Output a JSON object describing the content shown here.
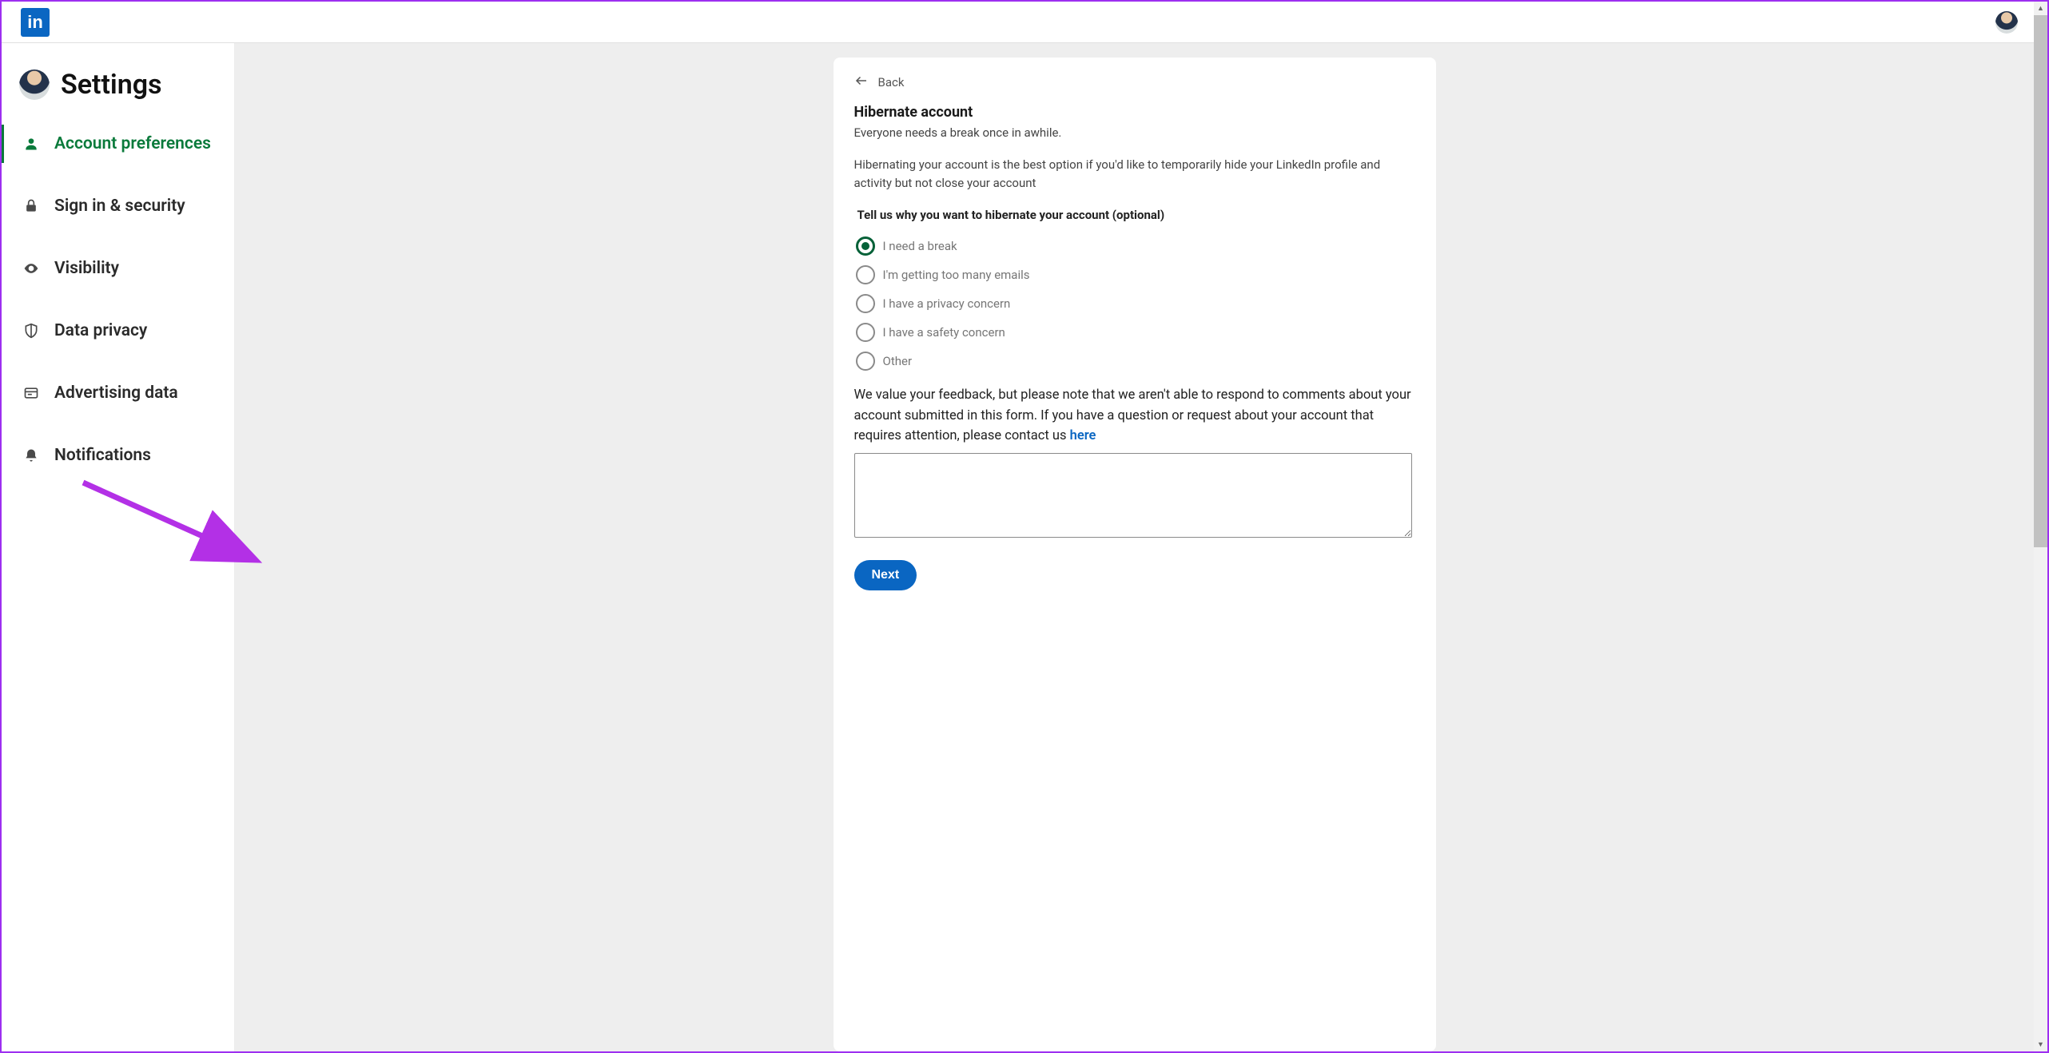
{
  "header": {
    "logo_text": "in"
  },
  "sidebar": {
    "title": "Settings",
    "items": [
      {
        "label": "Account preferences",
        "icon": "person-icon",
        "active": true
      },
      {
        "label": "Sign in & security",
        "icon": "lock-icon",
        "active": false
      },
      {
        "label": "Visibility",
        "icon": "eye-icon",
        "active": false
      },
      {
        "label": "Data privacy",
        "icon": "shield-icon",
        "active": false
      },
      {
        "label": "Advertising data",
        "icon": "ad-icon",
        "active": false
      },
      {
        "label": "Notifications",
        "icon": "bell-icon",
        "active": false
      }
    ]
  },
  "card": {
    "back_label": "Back",
    "heading": "Hibernate account",
    "subline": "Everyone needs a break once in awhile.",
    "description": "Hibernating your account is the best option if you'd like to temporarily hide your LinkedIn profile and activity but not close your account",
    "prompt": "Tell us why you want to hibernate your account (optional)",
    "options": [
      {
        "label": "I need a break",
        "selected": true
      },
      {
        "label": "I'm getting too many emails",
        "selected": false
      },
      {
        "label": "I have a privacy concern",
        "selected": false
      },
      {
        "label": "I have a safety concern",
        "selected": false
      },
      {
        "label": "Other",
        "selected": false
      }
    ],
    "feedback_text": "We value your feedback, but please note that we aren't able to respond to comments about your account submitted in this form. If you have a question or request about your account that requires attention, please contact us ",
    "feedback_link": "here",
    "textarea_value": "",
    "next_label": "Next"
  }
}
